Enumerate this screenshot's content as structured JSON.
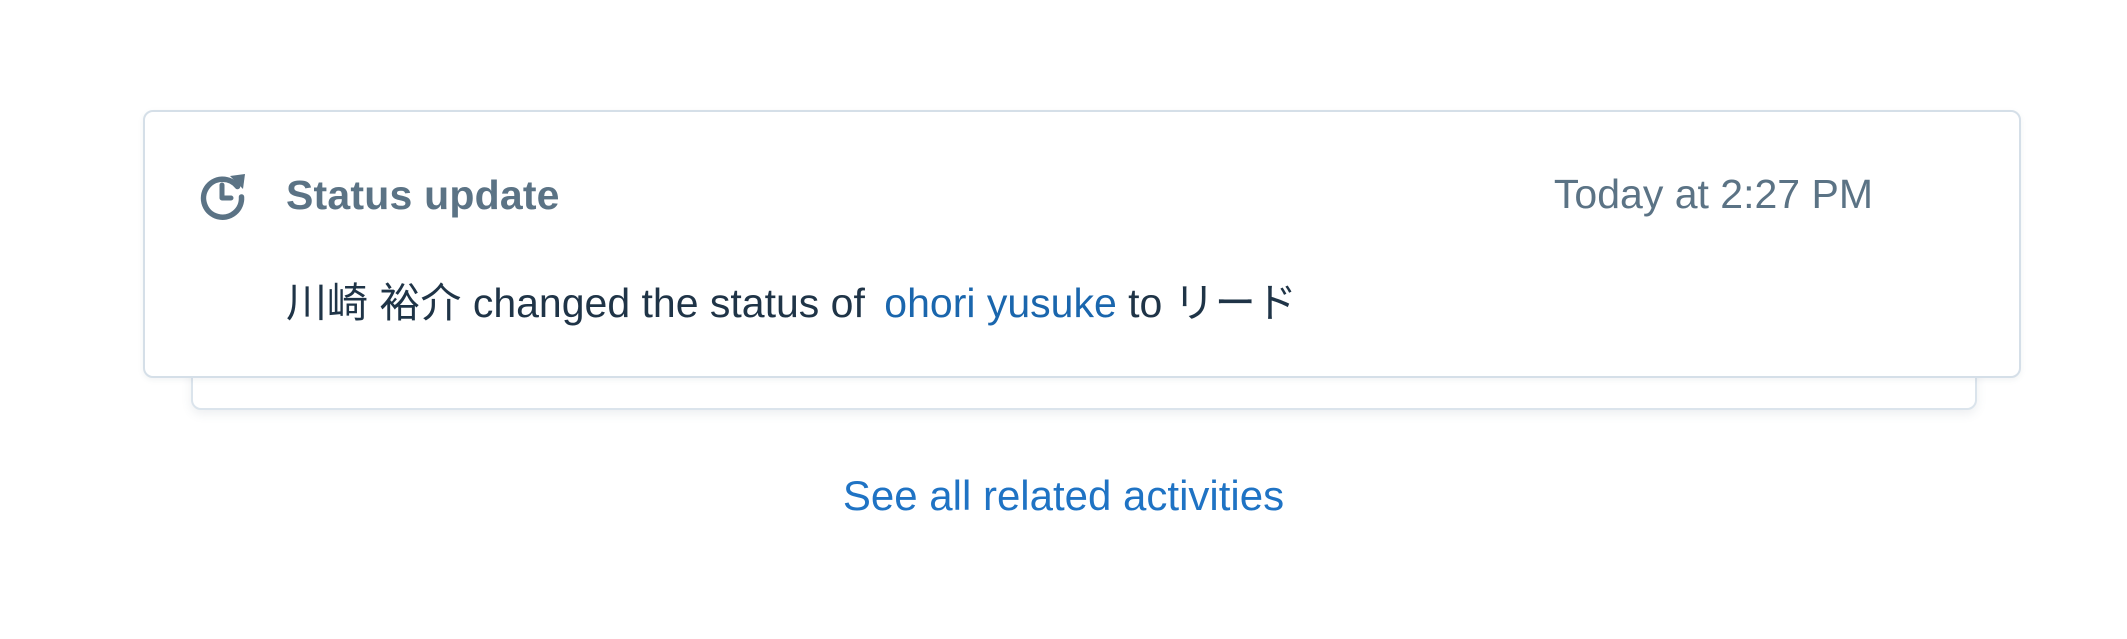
{
  "activity": {
    "icon": "clock-refresh-icon",
    "title": "Status update",
    "timestamp": "Today at 2:27 PM",
    "actor": "川崎 裕介",
    "action_text": "changed the status of",
    "target_name": "ohori yusuke",
    "to_text": "to",
    "new_status": "リード"
  },
  "footer": {
    "see_all_label": "See all related activities"
  },
  "colors": {
    "link": "#1a66ad",
    "muted": "#5b7385",
    "text": "#1f3447",
    "border": "#d5dfe8"
  }
}
